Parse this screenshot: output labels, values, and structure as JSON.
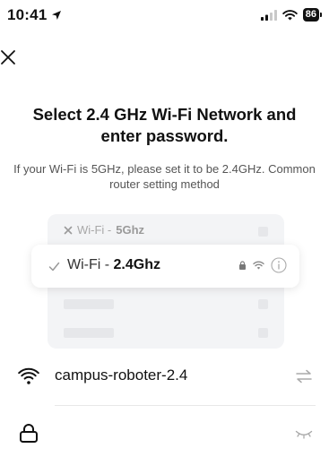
{
  "status_bar": {
    "time": "10:41",
    "battery": "86",
    "icons": [
      "location-arrow-icon",
      "signal-icon",
      "wifi-icon",
      "battery-icon"
    ]
  },
  "header": {
    "close_icon": "close-icon"
  },
  "title": "Select 2.4 GHz Wi-Fi Network and enter password.",
  "subtitle": "If your Wi-Fi is 5GHz, please set it to be 2.4GHz. Common router setting method",
  "illustration": {
    "network_5g": {
      "prefix": "Wi-Fi - ",
      "band": "5Ghz"
    },
    "network_24g": {
      "prefix": "Wi-Fi - ",
      "band": "2.4Ghz"
    }
  },
  "form": {
    "ssid": "campus-roboter-2.4",
    "password_value": "",
    "password_placeholder": ""
  },
  "colors": {
    "text": "#111111",
    "muted": "#555555",
    "card_bg": "#f3f4f6",
    "placeholder_bar": "#e6e7ea"
  }
}
